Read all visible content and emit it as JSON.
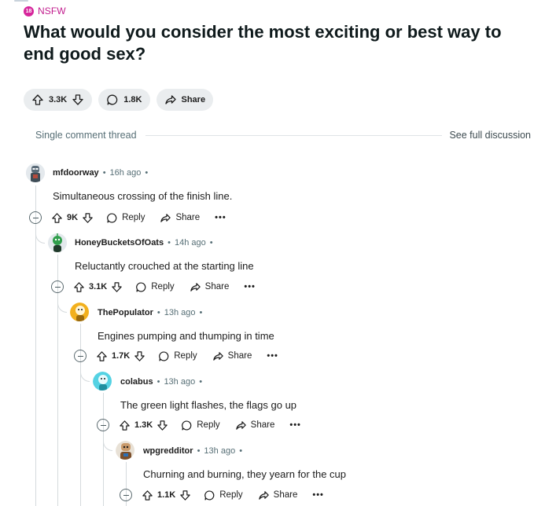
{
  "nsfw": {
    "badge": "18",
    "label": "NSFW"
  },
  "post": {
    "title": "What would you consider the most exciting or best way to end good sex?",
    "votes": "3.3K",
    "comments": "1.8K",
    "share_label": "Share"
  },
  "thread": {
    "label": "Single comment thread",
    "see_full": "See full discussion"
  },
  "labels": {
    "reply": "Reply",
    "share": "Share",
    "more": "•••"
  },
  "comments": [
    {
      "user": "mfdoorway",
      "time": "16h ago",
      "text": "Simultaneous crossing of the finish line.",
      "votes": "9K",
      "avatar_color": "#7a8fa0"
    },
    {
      "user": "HoneyBucketsOfOats",
      "time": "14h ago",
      "text": "Reluctantly crouched at the starting line",
      "votes": "3.1K",
      "avatar_color": "#2f9e4b"
    },
    {
      "user": "ThePopulator",
      "time": "13h ago",
      "text": "Engines pumping and thumping in time",
      "votes": "1.7K",
      "avatar_color": "#f2b01d"
    },
    {
      "user": "colabus",
      "time": "13h ago",
      "text": "The green light flashes, the flags go up",
      "votes": "1.3K",
      "avatar_color": "#55d2e3"
    },
    {
      "user": "wpgredditor",
      "time": "13h ago",
      "text": "Churning and burning, they yearn for the cup",
      "votes": "1.1K",
      "avatar_color": "#c99a6b"
    }
  ]
}
